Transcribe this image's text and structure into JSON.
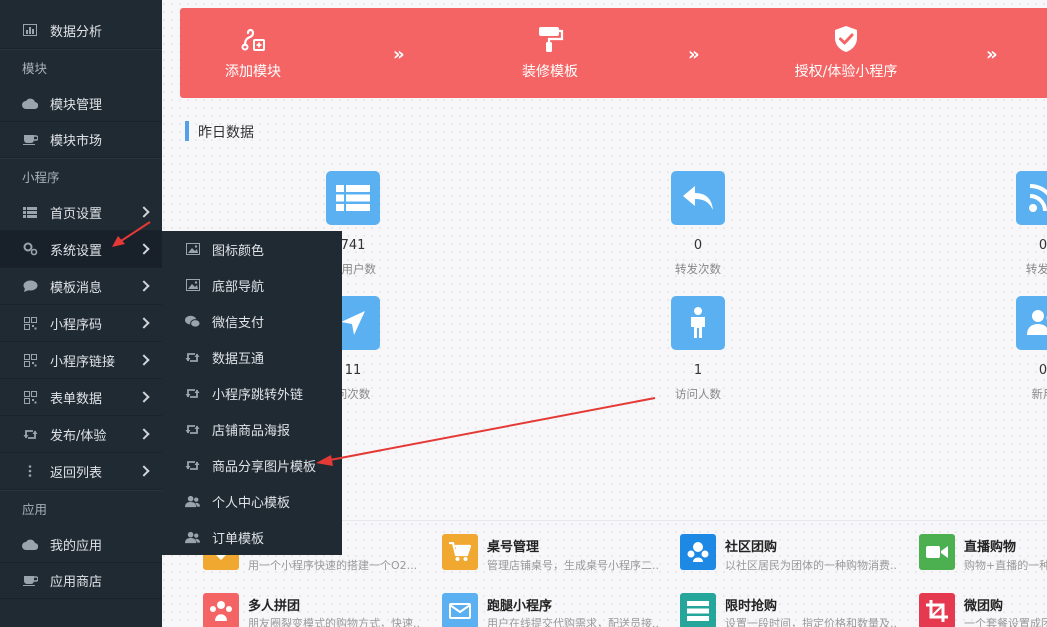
{
  "sidebar": {
    "items": [
      {
        "label": "数据分析",
        "icon": "bar-chart-icon"
      },
      {
        "group": "模块"
      },
      {
        "label": "模块管理",
        "icon": "cloud-icon"
      },
      {
        "label": "模块市场",
        "icon": "cup-icon"
      },
      {
        "group": "小程序"
      },
      {
        "label": "首页设置",
        "icon": "list-icon"
      },
      {
        "label": "系统设置",
        "icon": "gears-icon"
      },
      {
        "label": "模板消息",
        "icon": "chat-icon"
      },
      {
        "label": "小程序码",
        "icon": "qrcode-icon"
      },
      {
        "label": "小程序链接",
        "icon": "qrcode-icon"
      },
      {
        "label": "表单数据",
        "icon": "qrcode-icon"
      },
      {
        "label": "发布/体验",
        "icon": "retweet-icon"
      },
      {
        "label": "返回列表",
        "icon": "dots-icon"
      },
      {
        "group": "应用"
      },
      {
        "label": "我的应用",
        "icon": "cloud-icon"
      },
      {
        "label": "应用商店",
        "icon": "cup-icon"
      }
    ]
  },
  "submenu": {
    "items": [
      {
        "label": "图标颜色",
        "icon": "image-icon"
      },
      {
        "label": "底部导航",
        "icon": "image-icon"
      },
      {
        "label": "微信支付",
        "icon": "wechat-icon"
      },
      {
        "label": "数据互通",
        "icon": "retweet-icon"
      },
      {
        "label": "小程序跳转外链",
        "icon": "retweet-icon"
      },
      {
        "label": "店铺商品海报",
        "icon": "retweet-icon"
      },
      {
        "label": "商品分享图片模板",
        "icon": "retweet-icon"
      },
      {
        "label": "个人中心模板",
        "icon": "users-icon"
      },
      {
        "label": "订单模板",
        "icon": "users-icon"
      }
    ]
  },
  "steps": [
    {
      "label": "添加模块",
      "icon": "puzzle-add-icon"
    },
    {
      "label": "装修模板",
      "icon": "paint-roller-icon"
    },
    {
      "label": "授权/体验小程序",
      "icon": "shield-check-icon"
    }
  ],
  "step_arrow": "»",
  "yesterday": {
    "title": "昨日数据",
    "stats": [
      {
        "value": "741",
        "label": "计用户数",
        "icon": "list-icon"
      },
      {
        "value": "0",
        "label": "转发次数",
        "icon": "reply-icon"
      },
      {
        "value": "0",
        "label": "转发人",
        "icon": "rss-icon"
      },
      {
        "value": "11",
        "label": "问次数",
        "icon": "location-arrow-icon"
      },
      {
        "value": "1",
        "label": "访问人数",
        "icon": "person-icon"
      },
      {
        "value": "0",
        "label": "新用",
        "icon": "users-icon"
      }
    ]
  },
  "apps": [
    {
      "name": "",
      "desc": "用一个小程序快速的搭建一个O2...",
      "color": "#f0a830",
      "icon": "tag-icon"
    },
    {
      "name": "桌号管理",
      "desc": "管理店铺桌号，生成桌号小程序二...",
      "color": "#f0a830",
      "icon": "cart-icon"
    },
    {
      "name": "社区团购",
      "desc": "以社区居民为团体的一种购物消费...",
      "color": "#1e88e5",
      "icon": "users-icon"
    },
    {
      "name": "直播购物",
      "desc": "购物+直播的一种",
      "color": "#4caf50",
      "icon": "video-icon"
    },
    {
      "name": "多人拼团",
      "desc": "朋友圈裂变模式的购物方式，快速...",
      "color": "#f46465",
      "icon": "group-icon"
    },
    {
      "name": "跑腿小程序",
      "desc": "用户在线提交代购需求，配送员接...",
      "color": "#5ab0f0",
      "icon": "mail-icon"
    },
    {
      "name": "限时抢购",
      "desc": "设置一段时间，指定价格和数量及...",
      "color": "#26a69a",
      "icon": "server-icon"
    },
    {
      "name": "微团购",
      "desc": "一个套餐设置成团",
      "color": "#e53950",
      "icon": "crop-icon"
    }
  ]
}
